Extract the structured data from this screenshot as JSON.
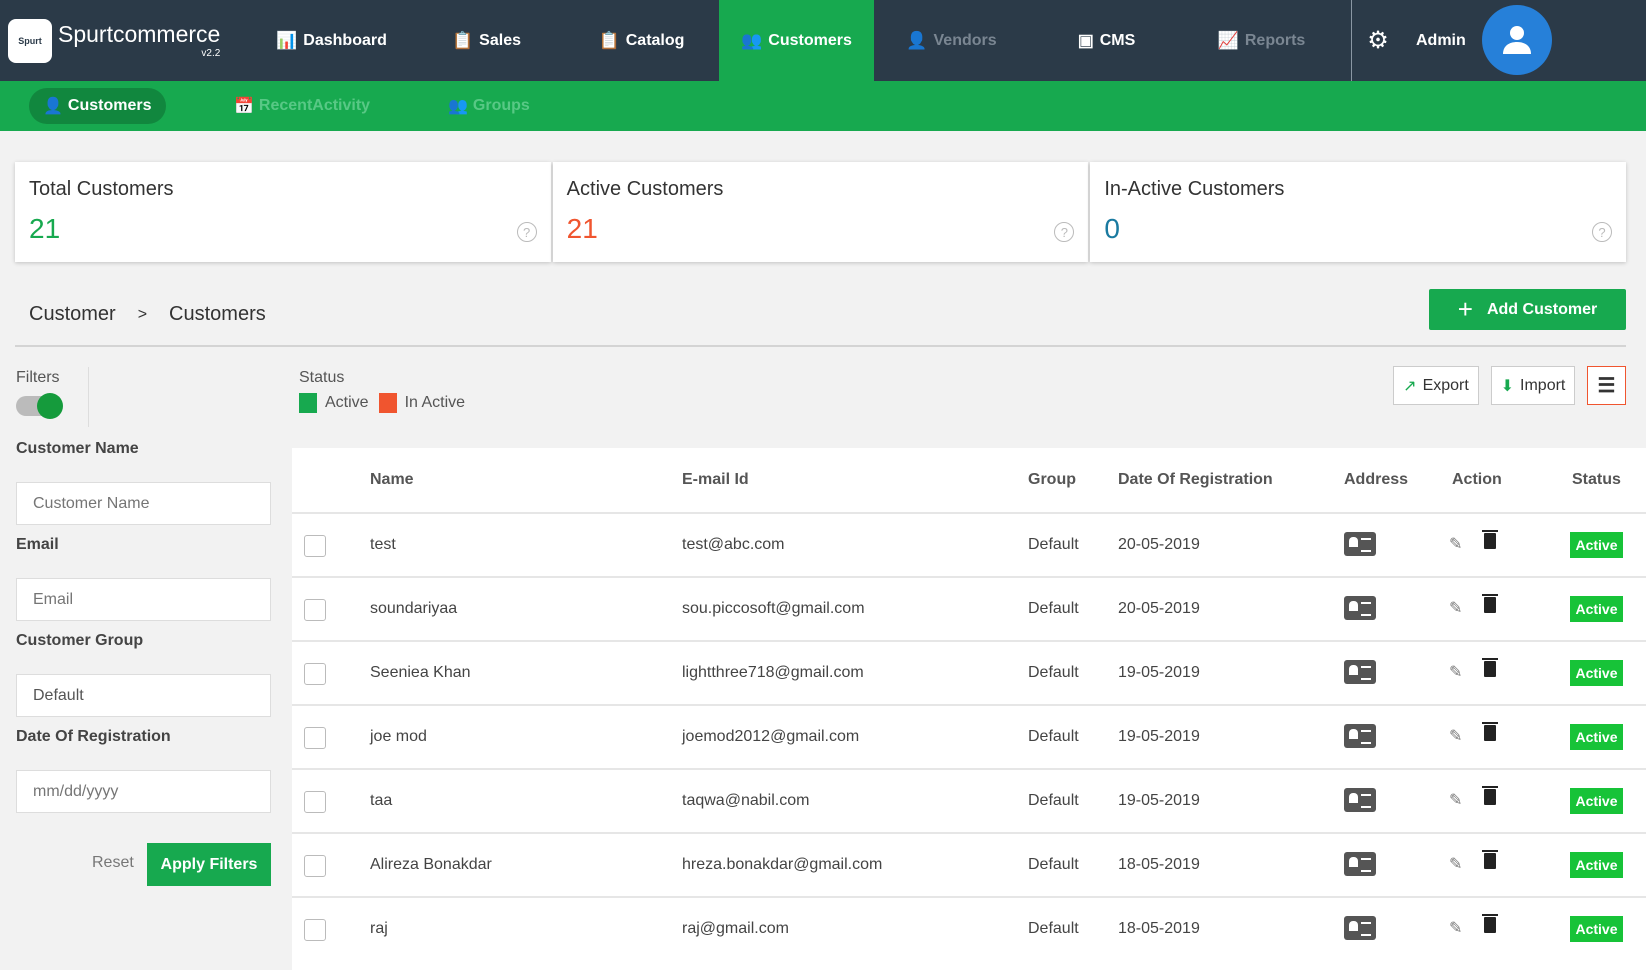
{
  "brand": {
    "name": "Spurtcommerce",
    "version": "v2.2",
    "logo_text": "Spurt"
  },
  "nav": {
    "items": [
      {
        "label": "Dashboard",
        "icon": "dashboard-icon"
      },
      {
        "label": "Sales",
        "icon": "clipboard-icon"
      },
      {
        "label": "Catalog",
        "icon": "clipboard-icon"
      },
      {
        "label": "Customers",
        "icon": "customers-icon"
      },
      {
        "label": "Vendors",
        "icon": "vendor-icon"
      },
      {
        "label": "CMS",
        "icon": "cms-icon"
      },
      {
        "label": "Reports",
        "icon": "reports-icon"
      }
    ],
    "active": "Customers",
    "user": "Admin"
  },
  "subnav": {
    "tabs": [
      {
        "label": "Customers"
      },
      {
        "label": "RecentActivity"
      },
      {
        "label": "Groups"
      }
    ]
  },
  "stats": [
    {
      "label": "Total Customers",
      "value": "21",
      "color": "#17a94f"
    },
    {
      "label": "Active Customers",
      "value": "21",
      "color": "#f0552f"
    },
    {
      "label": "In-Active Customers",
      "value": "0",
      "color": "#1a7aa0"
    }
  ],
  "breadcrumb": {
    "parent": "Customer",
    "separator": ">",
    "current": "Customers"
  },
  "add_button": "Add Customer",
  "filters": {
    "label": "Filters",
    "enabled": true,
    "status_label": "Status",
    "legend": [
      {
        "label": "Active",
        "color": "#17a94f"
      },
      {
        "label": "In Active",
        "color": "#f0552f"
      }
    ],
    "fields": [
      {
        "label": "Customer Name",
        "placeholder": "Customer Name"
      },
      {
        "label": "Email",
        "placeholder": "Email"
      },
      {
        "label": "Customer Group",
        "value": "Default"
      },
      {
        "label": "Date Of Registration",
        "placeholder": "mm/dd/yyyy"
      }
    ],
    "reset": "Reset",
    "apply": "Apply Filters"
  },
  "toolbar": {
    "export": "Export",
    "import": "Import"
  },
  "table": {
    "headers": [
      "Name",
      "E-mail Id",
      "Group",
      "Date Of Registration",
      "Address",
      "Action",
      "Status"
    ],
    "rows": [
      {
        "name": "test",
        "email": "test@abc.com",
        "group": "Default",
        "date": "20-05-2019",
        "status": "Active"
      },
      {
        "name": "soundariyaa",
        "email": "sou.piccosoft@gmail.com",
        "group": "Default",
        "date": "20-05-2019",
        "status": "Active"
      },
      {
        "name": "Seeniea Khan",
        "email": "lightthree718@gmail.com",
        "group": "Default",
        "date": "19-05-2019",
        "status": "Active"
      },
      {
        "name": "joe mod",
        "email": "joemod2012@gmail.com",
        "group": "Default",
        "date": "19-05-2019",
        "status": "Active"
      },
      {
        "name": "taa",
        "email": "taqwa@nabil.com",
        "group": "Default",
        "date": "19-05-2019",
        "status": "Active"
      },
      {
        "name": "Alireza Bonakdar",
        "email": "hreza.bonakdar@gmail.com",
        "group": "Default",
        "date": "18-05-2019",
        "status": "Active"
      },
      {
        "name": "raj",
        "email": "raj@gmail.com",
        "group": "Default",
        "date": "18-05-2019",
        "status": "Active"
      }
    ]
  }
}
